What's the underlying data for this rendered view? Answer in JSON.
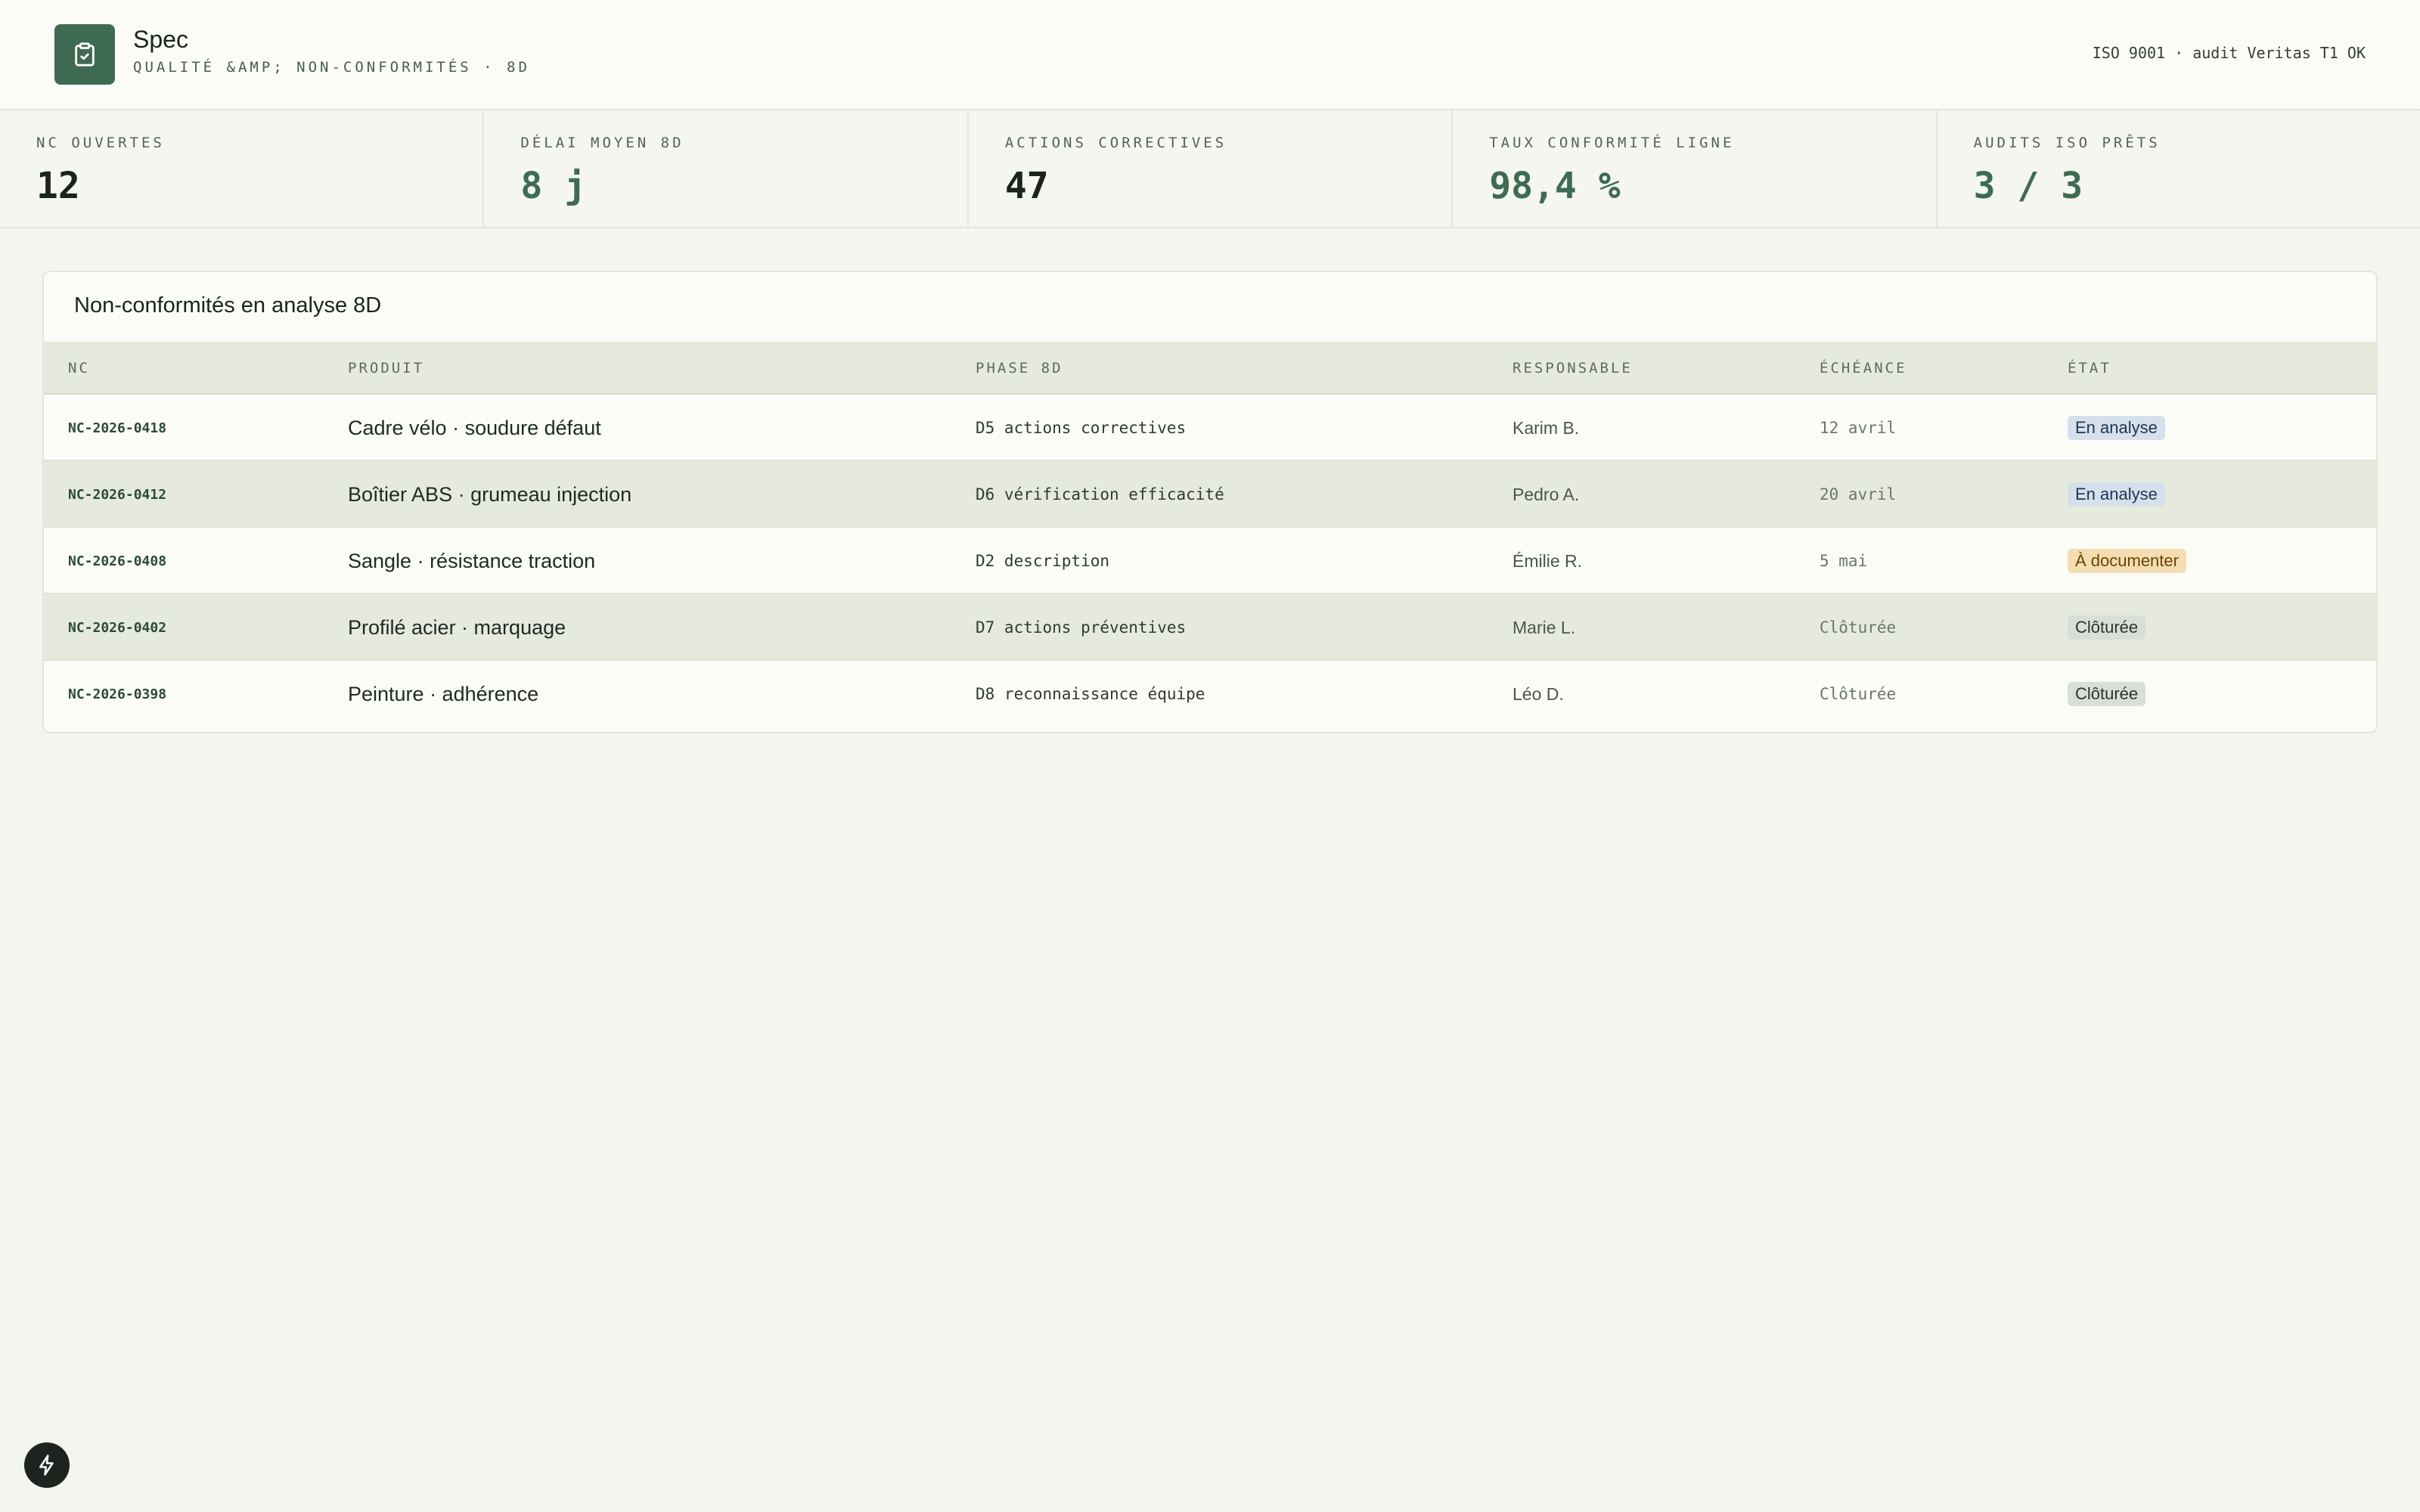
{
  "app": {
    "title": "Spec",
    "subtitle": "QUALITÉ &AMP; NON-CONFORMITÉS · 8D",
    "status": "ISO 9001 · audit Veritas T1 OK"
  },
  "kpis": [
    {
      "label": "NC OUVERTES",
      "value": "12"
    },
    {
      "label": "DÉLAI MOYEN 8D",
      "value": "8 j"
    },
    {
      "label": "ACTIONS CORRECTIVES",
      "value": "47"
    },
    {
      "label": "TAUX CONFORMITÉ LIGNE",
      "value": "98,4 %"
    },
    {
      "label": "AUDITS ISO PRÊTS",
      "value": "3 / 3"
    }
  ],
  "table": {
    "title": "Non-conformités en analyse 8D",
    "headers": {
      "nc": "NC",
      "produit": "PRODUIT",
      "phase": "PHASE 8D",
      "responsable": "RESPONSABLE",
      "echeance": "ÉCHÉANCE",
      "etat": "ÉTAT"
    },
    "rows": [
      {
        "nc": "NC-2026-0418",
        "produit": "Cadre vélo · soudure défaut",
        "phase": "D5 actions correctives",
        "responsable": "Karim B.",
        "echeance": "12 avril",
        "etat": "En analyse"
      },
      {
        "nc": "NC-2026-0412",
        "produit": "Boîtier ABS · grumeau injection",
        "phase": "D6 vérification efficacité",
        "responsable": "Pedro A.",
        "echeance": "20 avril",
        "etat": "En analyse"
      },
      {
        "nc": "NC-2026-0408",
        "produit": "Sangle · résistance traction",
        "phase": "D2 description",
        "responsable": "Émilie R.",
        "echeance": "5 mai",
        "etat": "À documenter"
      },
      {
        "nc": "NC-2026-0402",
        "produit": "Profilé acier · marquage",
        "phase": "D7 actions préventives",
        "responsable": "Marie L.",
        "echeance": "Clôturée",
        "etat": "Clôturée"
      },
      {
        "nc": "NC-2026-0398",
        "produit": "Peinture · adhérence",
        "phase": "D8 reconnaissance équipe",
        "responsable": "Léo D.",
        "echeance": "Clôturée",
        "etat": "Clôturée"
      }
    ]
  },
  "icons": {
    "logo": "clipboard-check-icon",
    "fab": "lightning-icon"
  },
  "colors": {
    "accent": "#3e6b52",
    "badge_analyse": "#d5e0ec",
    "badge_documenter": "#f4ddb0",
    "badge_cloturee": "#d9dfd6"
  }
}
